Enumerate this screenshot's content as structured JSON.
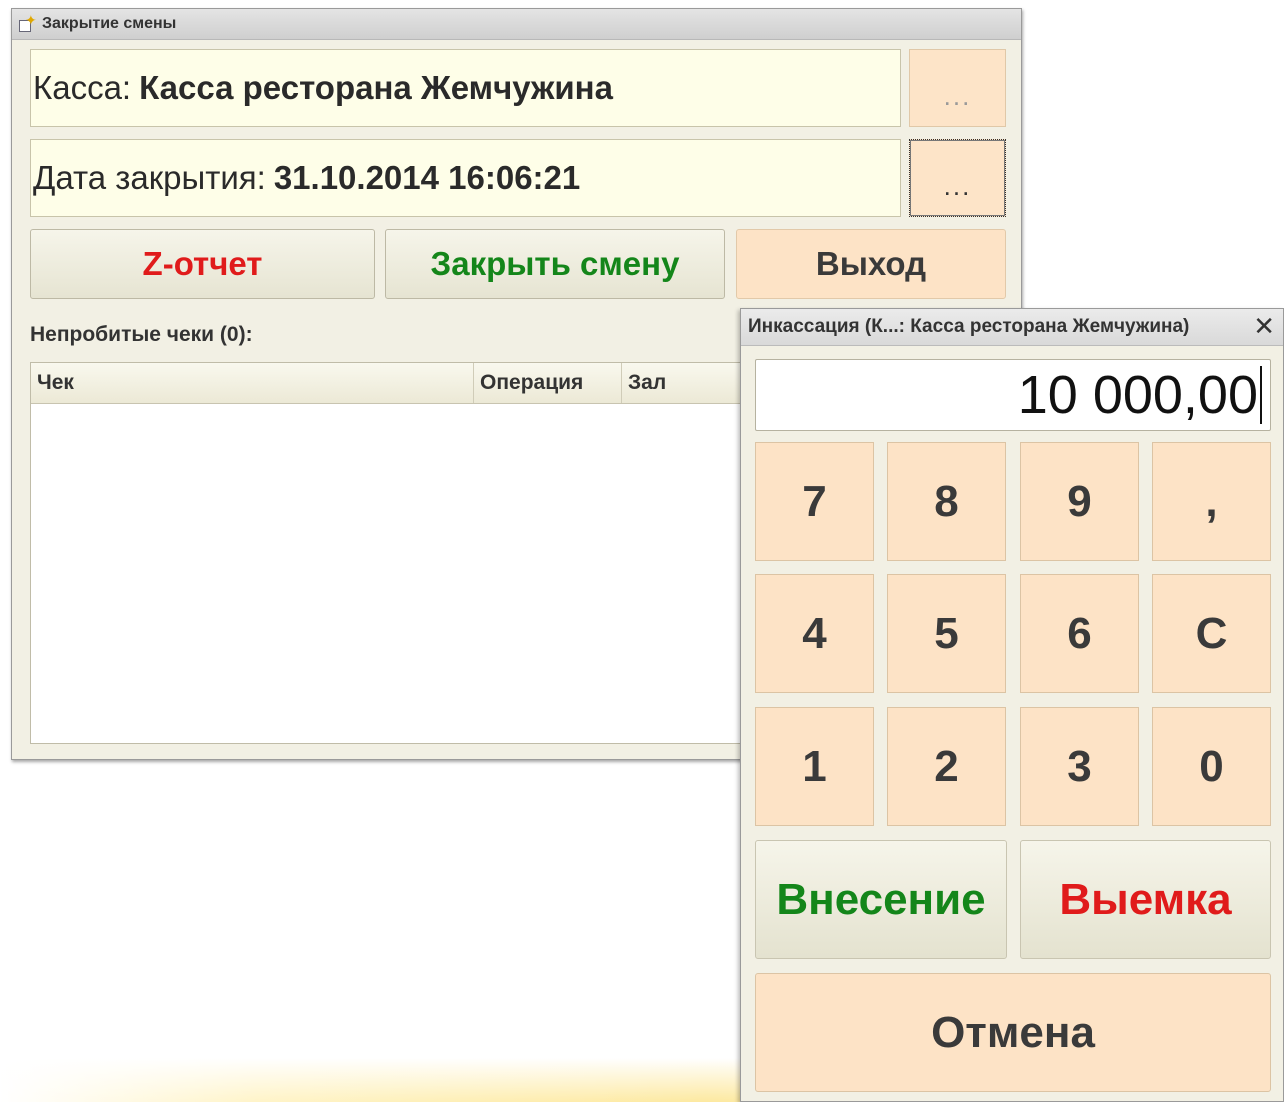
{
  "main_window": {
    "title": "Закрытие смены",
    "cash_register": {
      "label": "Касса:",
      "value": "Касса ресторана Жемчужина"
    },
    "close_date": {
      "label": "Дата закрытия:",
      "value": "31.10.2014 16:06:21"
    },
    "ellipsis": "...",
    "buttons": {
      "z_report": "Z-отчет",
      "close_shift": "Закрыть смену",
      "exit": "Выход"
    },
    "unpunched_label": "Непробитые чеки (0):",
    "grid_columns": [
      "Чек",
      "Операция",
      "Зал"
    ]
  },
  "keypad_dialog": {
    "title": "Инкассация (К...: Касса ресторана Жемчужина)",
    "close": "✕",
    "display_value": "10 000,00",
    "keys": [
      "7",
      "8",
      "9",
      ",",
      "4",
      "5",
      "6",
      "C",
      "1",
      "2",
      "3",
      "0"
    ],
    "deposit": "Внесение",
    "withdrawal": "Выемка",
    "cancel": "Отмена"
  },
  "colors": {
    "red": "#e01b1b",
    "green": "#14861a",
    "peach": "#fde3c6",
    "field": "#fefee8"
  },
  "icons": [
    "window-settings-icon",
    "close-icon"
  ]
}
